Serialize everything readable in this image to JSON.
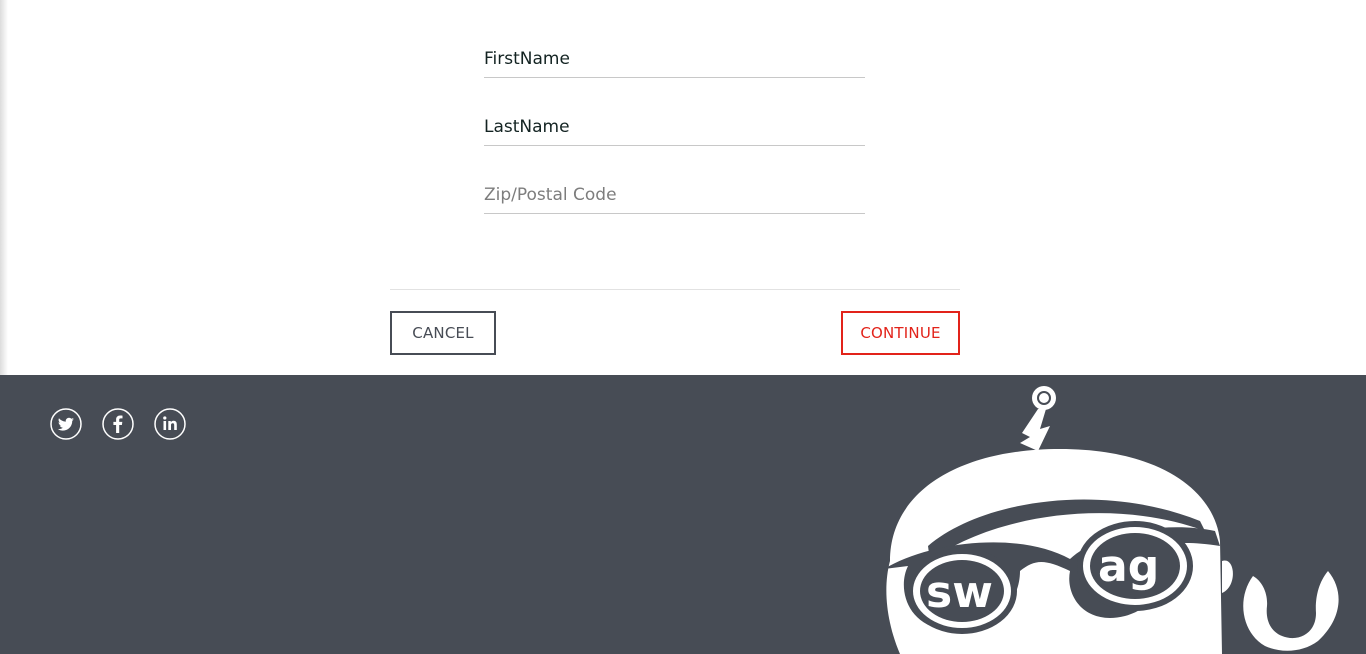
{
  "form": {
    "first_name": {
      "value": "FirstName",
      "placeholder": "First Name"
    },
    "last_name": {
      "value": "LastName",
      "placeholder": "Last Name"
    },
    "postal_code": {
      "value": "",
      "placeholder": "Zip/Postal Code"
    }
  },
  "actions": {
    "cancel_label": "CANCEL",
    "continue_label": "CONTINUE"
  },
  "footer": {
    "social": [
      {
        "icon": "twitter-icon"
      },
      {
        "icon": "facebook-icon"
      },
      {
        "icon": "linkedin-icon"
      }
    ],
    "mascot_text": "swag"
  },
  "colors": {
    "footer_bg": "#474c55",
    "accent_red": "#e2231a",
    "cancel_border": "#474c55"
  }
}
